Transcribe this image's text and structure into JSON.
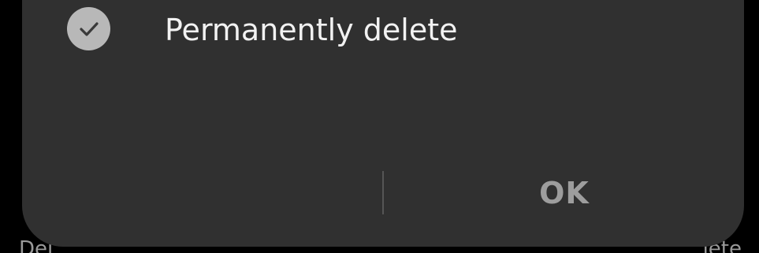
{
  "dialog": {
    "option": {
      "label": "Permanently delete",
      "checked": true,
      "icon": "check-icon"
    },
    "buttons": {
      "ok_label": "OK"
    }
  },
  "background": {
    "left_text": "Del",
    "right_text": "lete"
  },
  "colors": {
    "dialog_bg": "#303030",
    "screen_bg": "#000000",
    "check_circle": "#b8b8b8",
    "ok_text": "#9d9d9d"
  }
}
